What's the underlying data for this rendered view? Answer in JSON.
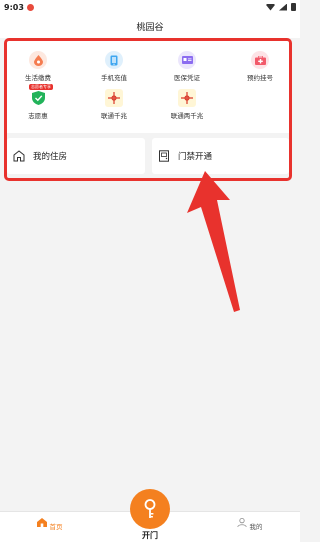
{
  "status": {
    "time": "9:03"
  },
  "header": {
    "title": "桃园谷"
  },
  "services": [
    {
      "label": "生活缴费",
      "icon": "water-drop-icon",
      "color": "#f57c50",
      "bg": "#fde8df"
    },
    {
      "label": "手机充值",
      "icon": "phone-icon",
      "color": "#3ea6f0",
      "bg": "#dff0fc"
    },
    {
      "label": "医保凭证",
      "icon": "medical-card-icon",
      "color": "#8b6cf0",
      "bg": "#ebe6fc"
    },
    {
      "label": "预约挂号",
      "icon": "medical-kit-icon",
      "color": "#f25a6a",
      "bg": "#fde3e6"
    },
    {
      "label": "志愿惠",
      "icon": "shield-check-icon",
      "color": "#22b35a",
      "bg": "#ffffff",
      "badge": "志愿者专享"
    },
    {
      "label": "联通千兆",
      "icon": "unicom-logo-icon",
      "color": "#d93a2b",
      "bg": "#fff6d6"
    },
    {
      "label": "联通两千兆",
      "icon": "unicom-logo-icon",
      "color": "#d93a2b",
      "bg": "#fff6d6"
    }
  ],
  "cards": {
    "housing": {
      "label": "我的住房",
      "icon": "house-icon"
    },
    "access": {
      "label": "门禁开通",
      "icon": "door-access-icon"
    }
  },
  "tabbar": {
    "home": {
      "label": "首页",
      "color": "#f4801f"
    },
    "open": {
      "label": "开门",
      "color": "#f4801f"
    },
    "mine": {
      "label": "我的"
    }
  },
  "colors": {
    "highlight": "#e8322d",
    "accent": "#f4801f"
  }
}
